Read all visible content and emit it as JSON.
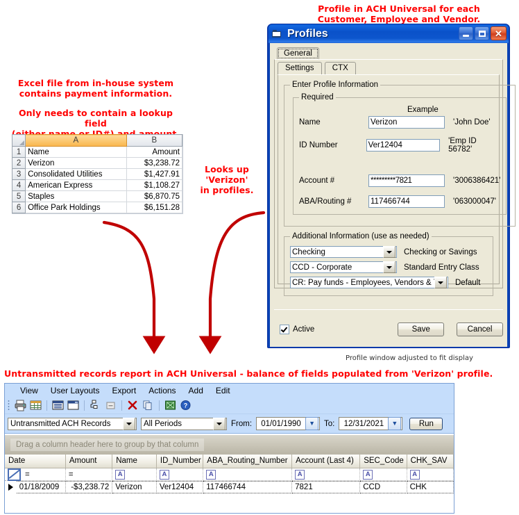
{
  "annotations": {
    "profile_note": "Profile in ACH Universal for each\nCustomer, Employee and Vendor.",
    "excel_note": "Excel file from in-house system\ncontains payment information.",
    "excel_note2": "Only needs to contain a lookup field\n(either name or ID#) and amount.",
    "lookup_note": "Looks up 'Verizon'\nin profiles.",
    "report_note": "Untransmitted records report in ACH Universal - balance of fields populated from 'Verizon' profile.",
    "profile_caption": "Profile window adjusted to fit display"
  },
  "excel": {
    "corner_icon": "select-all-icon",
    "columns": [
      "A",
      "B"
    ],
    "selected_column": "A",
    "rows": [
      {
        "num": "1",
        "a": "Name",
        "b": "Amount"
      },
      {
        "num": "2",
        "a": "Verizon",
        "b": "$3,238.72"
      },
      {
        "num": "3",
        "a": "Consolidated Utilities",
        "b": "$1,427.91"
      },
      {
        "num": "4",
        "a": "American Express",
        "b": "$1,108.27"
      },
      {
        "num": "5",
        "a": "Staples",
        "b": "$6,870.75"
      },
      {
        "num": "6",
        "a": "Office Park Holdings",
        "b": "$6,151.28"
      }
    ]
  },
  "profiles_window": {
    "title": "Profiles",
    "title_icon": "profile-folder-icon",
    "buttons": {
      "minimize": "minimize-icon",
      "maximize": "maximize-icon",
      "close": "close-icon"
    },
    "outer_tab": "General",
    "inner_tabs": [
      "Settings",
      "CTX"
    ],
    "active_inner_tab": "Settings",
    "group_outer": "Enter Profile Information",
    "group_required": "Required",
    "example_header": "Example",
    "fields": [
      {
        "label": "Name",
        "value": "Verizon",
        "example": "'John Doe'"
      },
      {
        "label": "ID Number",
        "value": "Ver12404",
        "example": "'Emp ID 56782'"
      },
      {
        "label": "Account #",
        "value": "*********7821",
        "example": "'3006386421'"
      },
      {
        "label": "ABA/Routing #",
        "value": "117466744",
        "example": "'063000047'"
      }
    ],
    "group_additional": "Additional Information (use as needed)",
    "dropdowns": [
      {
        "value": "Checking",
        "label": "Checking or Savings"
      },
      {
        "value": "CCD - Corporate",
        "label": "Standard Entry Class"
      },
      {
        "value": "CR: Pay funds - Employees, Vendors & Taxes",
        "label": "Default"
      }
    ],
    "active_checkbox_label": "Active",
    "active_checked": true,
    "save_label": "Save",
    "cancel_label": "Cancel"
  },
  "report_window": {
    "menu": [
      "View",
      "User Layouts",
      "Export",
      "Actions",
      "Add",
      "Edit"
    ],
    "toolbar_icons": [
      "print-icon",
      "grid-icon",
      "list-icon",
      "window-icon",
      "tree-icon",
      "collapse-icon",
      "delete-icon",
      "copy-icon",
      "excel-export-icon",
      "help-icon"
    ],
    "report_select": "Untransmitted ACH Records",
    "period_select": "All Periods",
    "from_label": "From:",
    "from_date": "01/01/1990",
    "to_label": "To:",
    "to_date": "12/31/2021",
    "run_label": "Run",
    "group_hint": "Drag a column header here to group by that column",
    "columns": [
      "Date",
      "Amount",
      "Name",
      "ID_Number",
      "ABA_Routing_Number",
      "Account (Last 4)",
      "SEC_Code",
      "CHK_SAV"
    ],
    "filter_row": [
      "filter-icon",
      "=",
      "=",
      "A",
      "A",
      "A",
      "A",
      "A",
      "A"
    ],
    "data_row": {
      "Date": "01/18/2009",
      "Amount": "-$3,238.72",
      "Name": "Verizon",
      "ID_Number": "Ver12404",
      "ABA_Routing_Number": "117466744",
      "Account (Last 4)": "7821",
      "SEC_Code": "CCD",
      "CHK_SAV": "CHK"
    }
  },
  "colors": {
    "annotation_red": "#FF0000",
    "xp_title_blue": "#0A42B5",
    "xp_face": "#ECE9D8",
    "report_blue": "#C5DDFB",
    "excel_selected_header": "#F9B64D"
  }
}
